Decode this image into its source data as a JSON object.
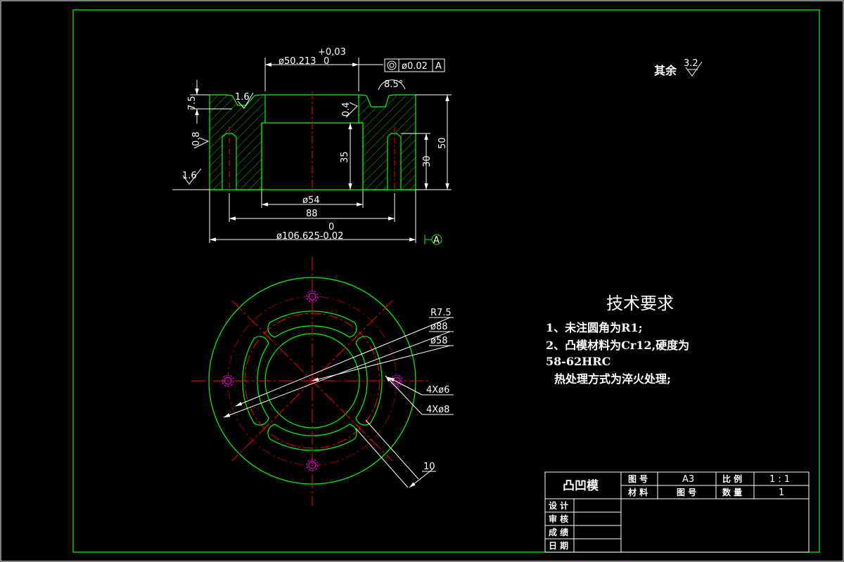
{
  "colors": {
    "background": "#000000",
    "outline": "#00ff00",
    "centerline": "#ff0000",
    "dimension": "#ffffff",
    "hole": "#ff00ff"
  },
  "surface_finish": {
    "prefix": "其余",
    "value": "3.2"
  },
  "section": {
    "tol_upper": "+0,03",
    "tol_lower": "0",
    "bore_top": "ø50.213",
    "tol_frame": {
      "symbol": "◎",
      "value": "ø0.02",
      "datum": "A"
    },
    "angle": "8.5°",
    "rough_1": "1.6",
    "rough_2": "1.6",
    "rough_3": "1.6",
    "rough_4": "0.8",
    "rough_5": "0.4",
    "h_groove": "7.5",
    "h_bore": "35",
    "h_pin": "30",
    "h_total": "50",
    "d_bore_bottom": "ø54",
    "d_pitch": "88",
    "d_outer_tol": "0",
    "d_outer": "ø106.625-0,02",
    "datum": "A"
  },
  "plan": {
    "r_slot": "R7.5",
    "d_slot_pitch": "ø88",
    "d_inner": "ø58",
    "holes_small": "4Xø6",
    "holes_large": "4Xø8",
    "width": "10"
  },
  "tech": {
    "title": "技术要求",
    "line1": "1、未注圆角为R1;",
    "line2": "2、凸模材料为Cr12,硬度为",
    "line3": "58-62HRC",
    "line4": "热处理方式为淬火处理;"
  },
  "title_block": {
    "part_name": "凸凹模",
    "drawing_no_label": "图 号",
    "drawing_no": "A3",
    "scale_label": "比 例",
    "scale": "1 : 1",
    "material_label": "材 料",
    "material": "图 号",
    "qty_label": "数 量",
    "qty": "1",
    "design": "设 计",
    "review": "审 核",
    "grade": "成 绩",
    "date": "日 期"
  }
}
